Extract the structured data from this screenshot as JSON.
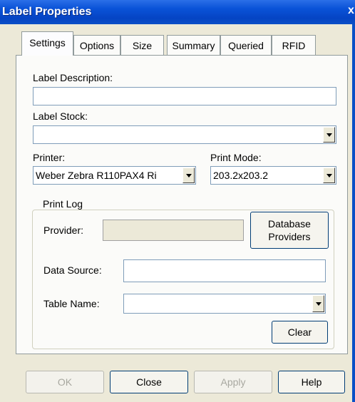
{
  "window": {
    "title": "Label Properties",
    "close_glyph": "x"
  },
  "tabs": [
    {
      "label": "Settings"
    },
    {
      "label": "Options"
    },
    {
      "label": "Size"
    },
    {
      "label": "Summary"
    },
    {
      "label": "Queried"
    },
    {
      "label": "RFID"
    }
  ],
  "settings": {
    "label_description": {
      "label": "Label Description:",
      "value": ""
    },
    "label_stock": {
      "label": "Label Stock:",
      "value": ""
    },
    "printer": {
      "label": "Printer:",
      "value": "Weber Zebra R110PAX4 Ri"
    },
    "print_mode": {
      "label": "Print Mode:",
      "value": "203.2x203.2"
    },
    "print_log": {
      "legend": "Print Log",
      "provider": {
        "label": "Provider:",
        "value": ""
      },
      "database_providers_button": {
        "line1": "Database",
        "line2": "Providers"
      },
      "data_source": {
        "label": "Data Source:",
        "value": ""
      },
      "table_name": {
        "label": "Table Name:",
        "value": ""
      },
      "clear_button": "Clear"
    }
  },
  "footer": {
    "ok": "OK",
    "close": "Close",
    "apply": "Apply",
    "help": "Help"
  },
  "colors": {
    "titlebar": "#0a53d8",
    "dialog_bg": "#ece9d8",
    "panel_bg": "#fbfbf9"
  }
}
